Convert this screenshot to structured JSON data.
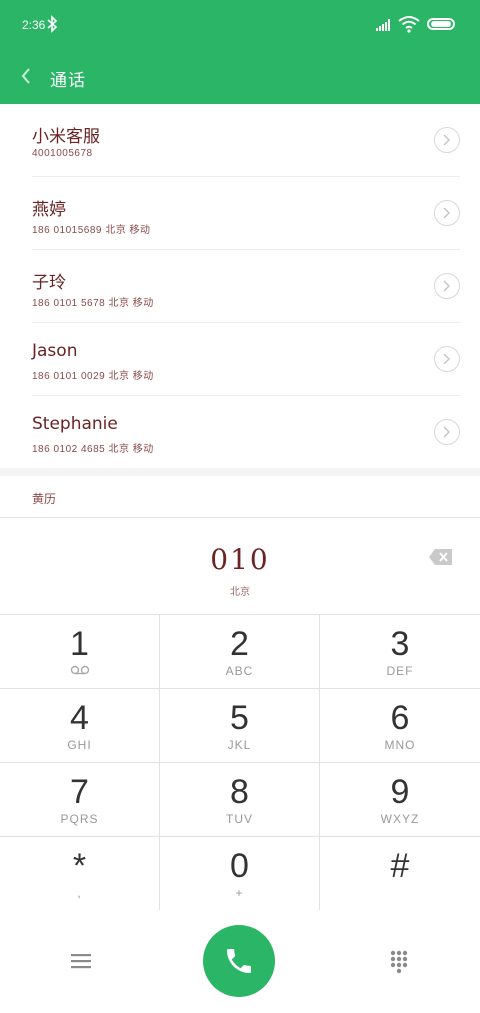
{
  "status_bar": {
    "time": "2:36"
  },
  "header": {
    "title": "通话"
  },
  "contacts": [
    {
      "name": "小米客服",
      "detail": "4001005678"
    },
    {
      "name": "燕婷",
      "detail": "186 01015689 北京 移动"
    },
    {
      "name": "子玲",
      "detail": "186 0101 5678 北京 移动"
    },
    {
      "name": "Jason",
      "detail": "186 0101 0029 北京 移动"
    },
    {
      "name": "Stephanie",
      "detail": "186 0102 4685 北京 移动"
    }
  ],
  "suggestion": "黄历",
  "dialer": {
    "number": "010",
    "location": "北京"
  },
  "keypad": [
    {
      "digit": "1",
      "letters": ""
    },
    {
      "digit": "2",
      "letters": "ABC"
    },
    {
      "digit": "3",
      "letters": "DEF"
    },
    {
      "digit": "4",
      "letters": "GHI"
    },
    {
      "digit": "5",
      "letters": "JKL"
    },
    {
      "digit": "6",
      "letters": "MNO"
    },
    {
      "digit": "7",
      "letters": "PQRS"
    },
    {
      "digit": "8",
      "letters": "TUV"
    },
    {
      "digit": "9",
      "letters": "WXYZ"
    },
    {
      "digit": "*",
      "letters": ","
    },
    {
      "digit": "0",
      "letters": "+"
    },
    {
      "digit": "#",
      "letters": ""
    }
  ],
  "colors": {
    "accent": "#2bb566",
    "contact_text": "#6b2323"
  },
  "icons": {
    "back": "back-arrow-icon",
    "voicemail": "voicemail-icon",
    "backspace": "backspace-icon",
    "call": "phone-icon",
    "menu": "menu-icon",
    "dialpad": "dialpad-icon"
  }
}
